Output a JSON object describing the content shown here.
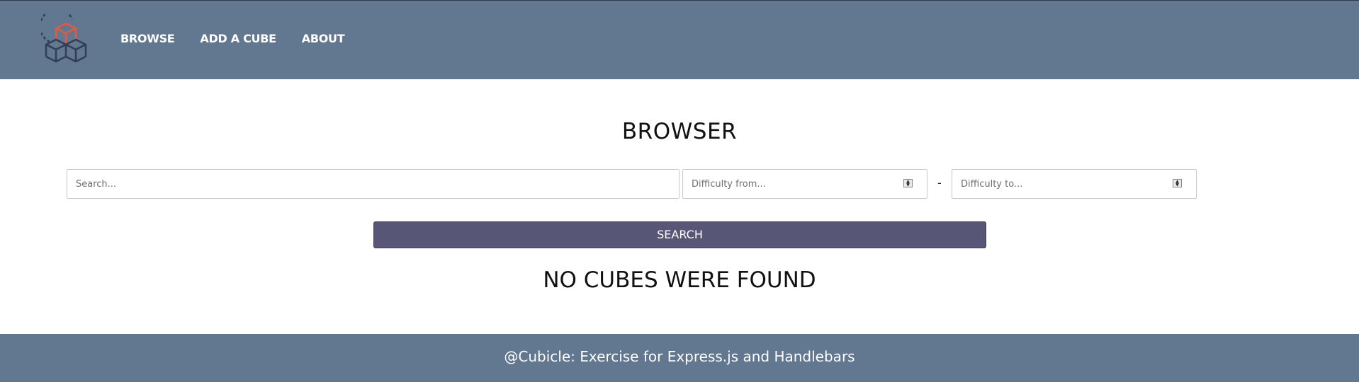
{
  "header": {
    "logo_icon": "cubes-logo-icon",
    "nav": [
      {
        "label": "BROWSE"
      },
      {
        "label": "ADD A CUBE"
      },
      {
        "label": "ABOUT"
      }
    ]
  },
  "main": {
    "title": "BROWSER",
    "search": {
      "placeholder": "Search...",
      "value": ""
    },
    "difficulty_from": {
      "placeholder": "Difficulty from...",
      "value": ""
    },
    "separator": "-",
    "difficulty_to": {
      "placeholder": "Difficulty to...",
      "value": ""
    },
    "search_button": "SEARCH",
    "empty_message": "NO CUBES WERE FOUND"
  },
  "footer": {
    "text": "@Cubicle: Exercise for Express.js and Handlebars"
  },
  "colors": {
    "header_bg": "#627890",
    "button_bg": "#585677",
    "logo_accent": "#e8583e",
    "logo_dark": "#2f3f55"
  }
}
